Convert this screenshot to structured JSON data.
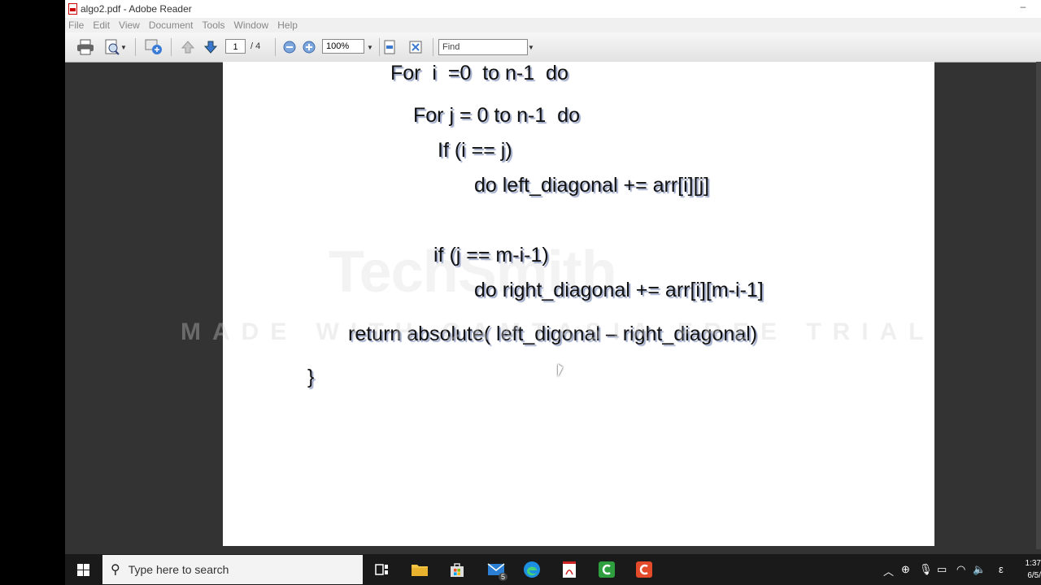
{
  "window": {
    "title": "algo2.pdf - Adobe Reader",
    "minimize_glyph": "–"
  },
  "menu": [
    "File",
    "Edit",
    "View",
    "Document",
    "Tools",
    "Window",
    "Help"
  ],
  "toolbar": {
    "page_current": "1",
    "page_total": "/ 4",
    "zoom": "100%",
    "find_placeholder": "Find"
  },
  "document": {
    "lines": [
      "For  i  =0  to n-1  do",
      "For j = 0 to n-1  do",
      "If (i == j)",
      "do left_diagonal += arr[i][j]",
      "if (j == m-i-1)",
      "do right_diagonal += arr[i][m-i-1]",
      "return absolute( left_digonal – right_diagonal)",
      "}"
    ]
  },
  "watermark": {
    "logo": "TechSmith",
    "text": "MADE WITH CAMTASIA FREE TRIAL"
  },
  "taskbar": {
    "search_placeholder": "Type here to search",
    "mail_badge": "5",
    "input_indicator": "ε",
    "time": "1:37",
    "date": "6/5/"
  },
  "colors": {
    "acrobat_red": "#cc2222",
    "camtasia_green": "#2e9e3e",
    "camtasia_orange": "#e34b2a"
  }
}
